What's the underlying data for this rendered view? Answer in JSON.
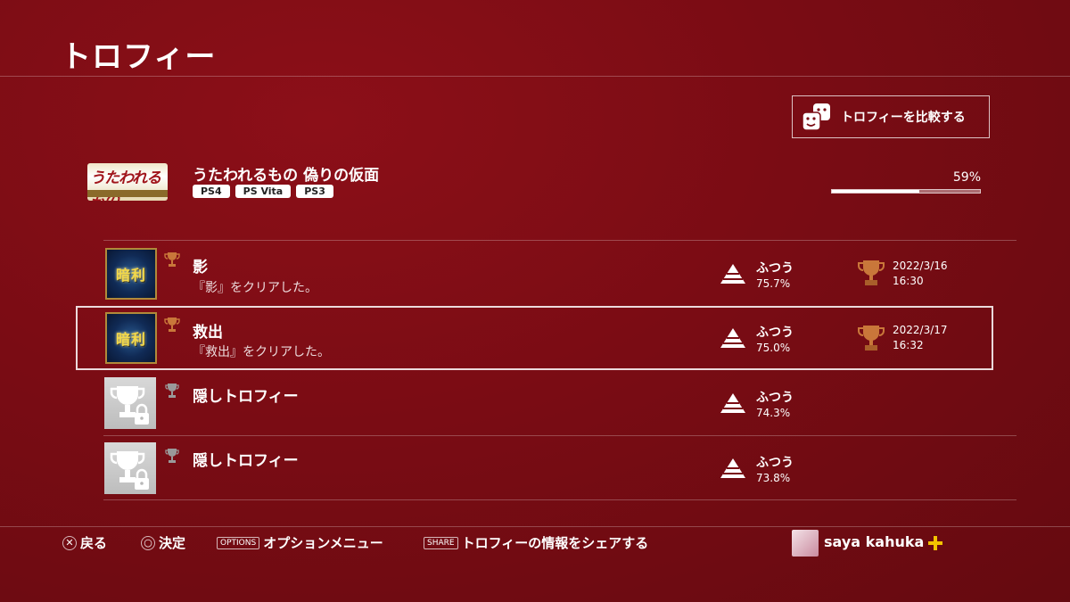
{
  "header": {
    "title": "トロフィー"
  },
  "compare_button": {
    "label": "トロフィーを比較する",
    "icon": "compare-faces-icon"
  },
  "game": {
    "title": "うたわれるもの 偽りの仮面",
    "logo_text": "うたわれるもの",
    "platforms": [
      "PS4",
      "PS Vita",
      "PS3"
    ],
    "progress_label": "59%",
    "progress_value": 0.59
  },
  "trophies": [
    {
      "name": "影",
      "description": "『影』をクリアした。",
      "thumb_text": "暗利",
      "trophy_type": "bronze",
      "rarity": "ふつう",
      "rate": "75.7%",
      "earned_date": "2022/3/16",
      "earned_time": "16:30"
    },
    {
      "name": "救出",
      "description": "『救出』をクリアした。",
      "thumb_text": "暗利",
      "trophy_type": "bronze",
      "rarity": "ふつう",
      "rate": "75.0%",
      "earned_date": "2022/3/17",
      "earned_time": "16:32"
    },
    {
      "name": "隠しトロフィー",
      "description": "",
      "trophy_type": "hidden",
      "rarity": "ふつう",
      "rate": "74.3%"
    },
    {
      "name": "隠しトロフィー",
      "description": "",
      "trophy_type": "hidden",
      "rarity": "ふつう",
      "rate": "73.8%"
    }
  ],
  "footer": {
    "back": {
      "button": "✕",
      "label": "戻る"
    },
    "confirm": {
      "button": "○",
      "label": "決定"
    },
    "options": {
      "key": "OPTIONS",
      "label": "オプションメニュー"
    },
    "share": {
      "key": "SHARE",
      "label": "トロフィーの情報をシェアする"
    },
    "user": {
      "name": "saya kahuka",
      "plus_icon": "ps-plus-icon"
    }
  },
  "colors": {
    "background": "#7a0c14",
    "bronze": "#c9773a",
    "plus": "#f3c300"
  }
}
